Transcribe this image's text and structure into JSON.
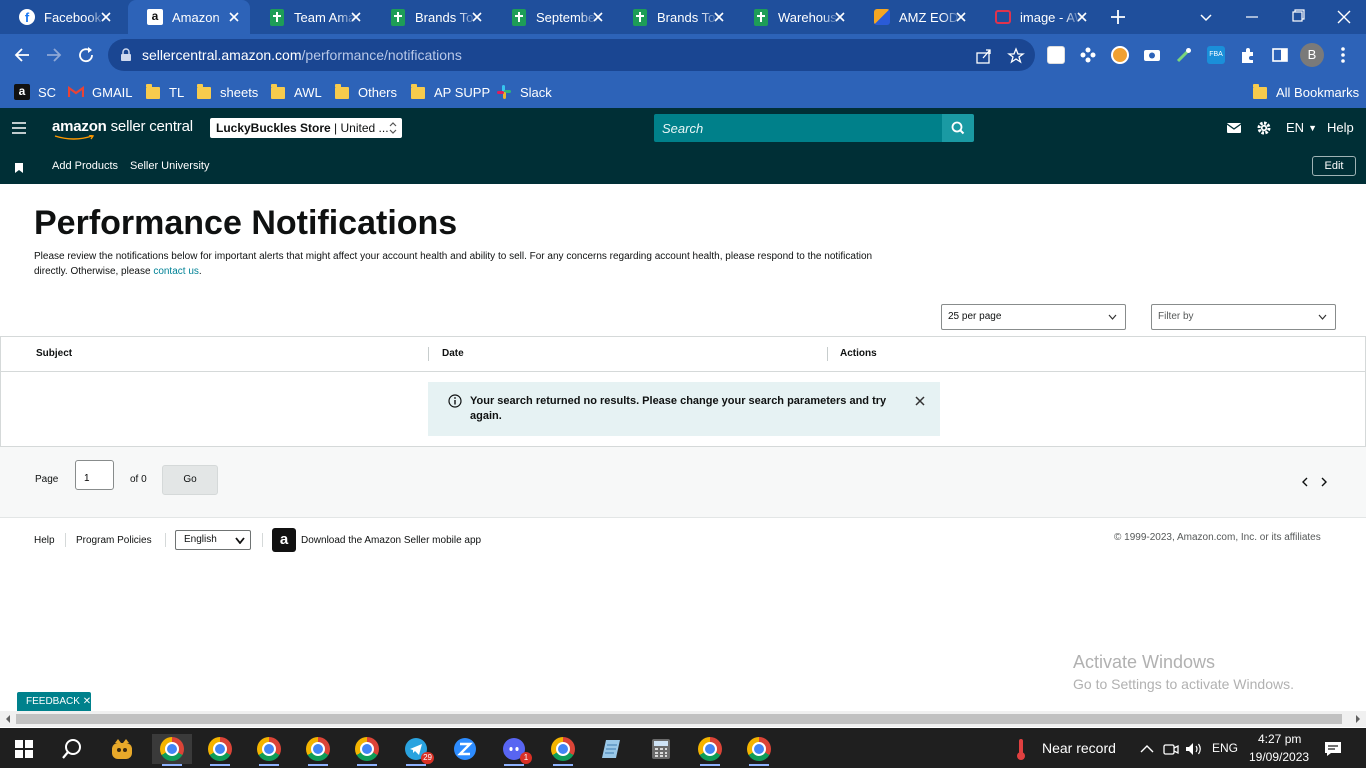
{
  "browser": {
    "tabs": [
      {
        "title": "Facebook",
        "icon": "facebook-icon"
      },
      {
        "title": "Amazon",
        "icon": "amazon-icon"
      },
      {
        "title": "Team Amazon",
        "icon": "google-sheets-icon"
      },
      {
        "title": "Brands To",
        "icon": "google-sheets-icon"
      },
      {
        "title": "September",
        "icon": "google-sheets-icon"
      },
      {
        "title": "Brands To",
        "icon": "google-sheets-icon"
      },
      {
        "title": "Warehouse",
        "icon": "google-sheets-icon"
      },
      {
        "title": "AMZ EOD",
        "icon": "eod-app-icon"
      },
      {
        "title": "image - AWL",
        "icon": "image-icon"
      }
    ],
    "url_host": "sellercentral.amazon.com",
    "url_path": "/performance/notifications",
    "profile_initial": "B",
    "bookmarks": [
      {
        "label": "SC",
        "icon": "amazon-icon"
      },
      {
        "label": "GMAIL",
        "icon": "gmail-icon"
      },
      {
        "label": "TL",
        "icon": "folder-icon"
      },
      {
        "label": "sheets",
        "icon": "folder-icon"
      },
      {
        "label": "AWL",
        "icon": "folder-icon"
      },
      {
        "label": "Others",
        "icon": "folder-icon"
      },
      {
        "label": "AP SUPP",
        "icon": "folder-icon"
      },
      {
        "label": "Slack",
        "icon": "slack-icon"
      }
    ],
    "all_bookmarks": "All Bookmarks"
  },
  "header": {
    "logo_amazon": "amazon",
    "logo_suffix": "seller central",
    "store_name": "LuckyBuckles Store",
    "store_region": " | United ...",
    "search_placeholder": "Search",
    "language": "EN",
    "help": "Help",
    "nav_links": [
      "Add Products",
      "Seller University"
    ],
    "edit": "Edit"
  },
  "main": {
    "title": "Performance Notifications",
    "intro": "Please review the notifications below for important alerts that might affect your account health and ability to sell. For any concerns regarding account health, please respond to the notification directly. Otherwise, please ",
    "intro_link": "contact us",
    "intro_end": ".",
    "per_page": "25 per page",
    "filter_placeholder": "Filter by",
    "columns": [
      "Subject",
      "Date",
      "Actions"
    ],
    "alert_message": "Your search returned no results. Please change your search parameters and try again.",
    "page_label": "Page",
    "page_value": "1",
    "page_of": "of 0",
    "go": "Go"
  },
  "footer": {
    "help": "Help",
    "program_policies": "Program Policies",
    "language": "English",
    "app_download": "Download the Amazon Seller mobile app",
    "copyright": "© 1999-2023, Amazon.com, Inc. or its affiliates",
    "feedback": "FEEDBACK"
  },
  "watermark": {
    "line1": "Activate Windows",
    "line2": "Go to Settings to activate Windows."
  },
  "taskbar": {
    "weather": "Near record",
    "input_language": "ENG",
    "time": "4:27 pm",
    "date": "19/09/2023",
    "telegram_badge": "29",
    "discord_badge": "1"
  },
  "colors": {
    "chrome_tabstrip": "#1f4f9c",
    "chrome_toolbar": "#2d63b8",
    "seller_header": "#002f36",
    "search_teal": "#00808a",
    "link_teal": "#008296",
    "alert_bg": "#e6f2f3"
  }
}
